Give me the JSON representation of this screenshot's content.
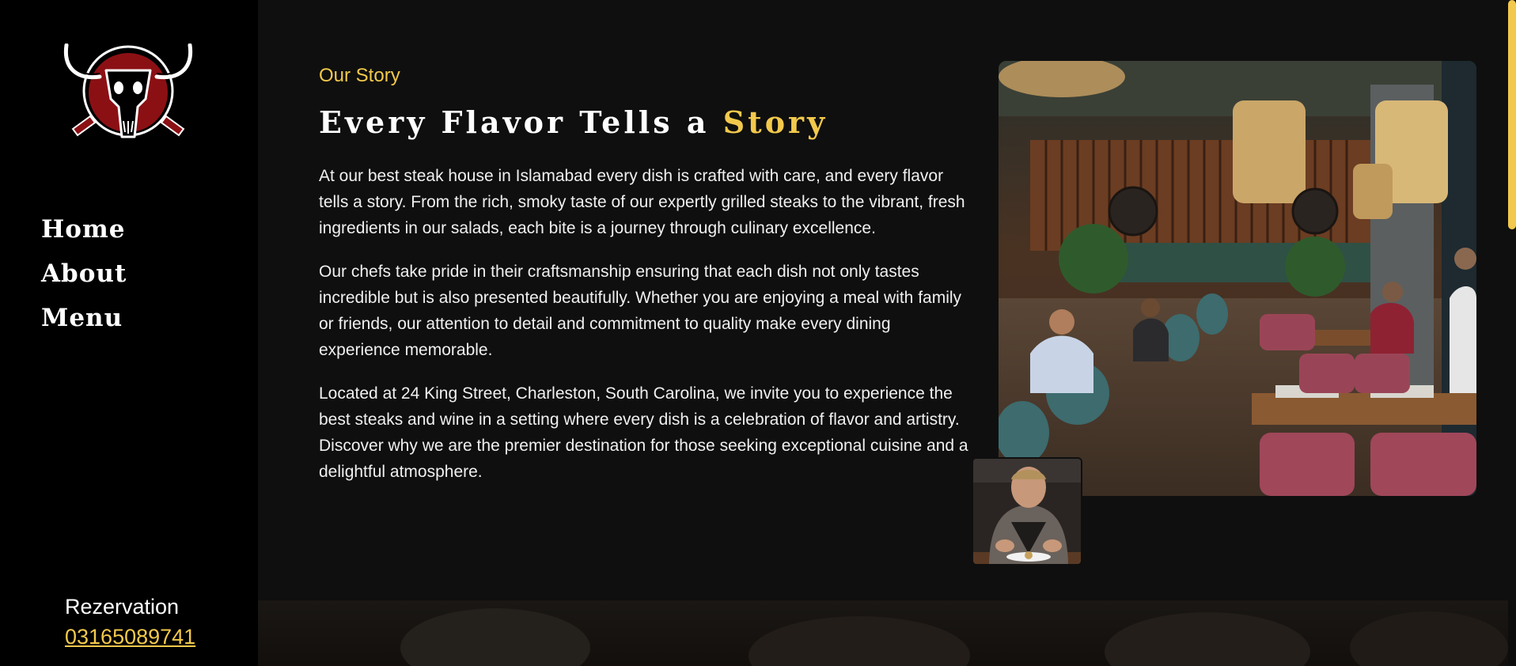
{
  "sidebar": {
    "logo_name": "bull-skull-logo",
    "nav": [
      {
        "label": "Home"
      },
      {
        "label": "About"
      },
      {
        "label": "Menu"
      }
    ],
    "reservation": {
      "label": "Rezervation",
      "phone": "03165089741"
    }
  },
  "story": {
    "eyebrow": "Our Story",
    "heading_main": "Every Flavor Tells a ",
    "heading_accent": "Story",
    "paragraphs": [
      "At our best steak house in Islamabad every dish is crafted with care, and every flavor tells a story. From the rich, smoky taste of our expertly grilled steaks to the vibrant, fresh ingredients in our salads, each bite is a journey through culinary excellence.",
      "Our chefs take pride in their craftsmanship ensuring that each dish not only tastes incredible but is also presented beautifully. Whether you are enjoying a meal with family or friends, our attention to detail and commitment to quality make every dining experience memorable.",
      "Located at 24 King Street, Charleston, South Carolina, we invite you to experience the best steaks and wine in a setting where every dish is a celebration of flavor and artistry. Discover why we are the premier destination for those seeking exceptional cuisine and a delightful atmosphere."
    ]
  },
  "images": {
    "main": "restaurant-interior-photo",
    "small": "chef-plating-photo"
  },
  "colors": {
    "accent": "#f2c94c",
    "sidebar_bg": "#000000",
    "main_bg": "#0f0f0f",
    "text": "#ffffff",
    "logo_red": "#8b1014"
  }
}
